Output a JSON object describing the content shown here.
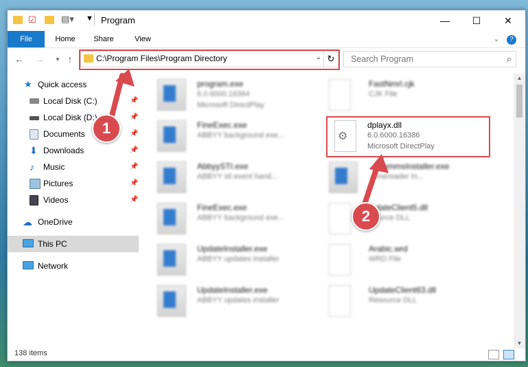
{
  "window": {
    "title": "Program"
  },
  "ribbon": {
    "tabs": [
      "File",
      "Home",
      "Share",
      "View"
    ]
  },
  "address": {
    "path": "C:\\Program Files\\Program Directory"
  },
  "search": {
    "placeholder": "Search Program"
  },
  "nav": {
    "quick_access": "Quick access",
    "items": [
      {
        "label": "Local Disk (C:)"
      },
      {
        "label": "Local Disk (D:)"
      },
      {
        "label": "Documents"
      },
      {
        "label": "Downloads"
      },
      {
        "label": "Music"
      },
      {
        "label": "Pictures"
      },
      {
        "label": "Videos"
      }
    ],
    "onedrive": "OneDrive",
    "thispc": "This PC",
    "network": "Network"
  },
  "files": [
    {
      "name": "program.exe",
      "line1": "6.0.6000.16384",
      "line2": "Microsoft DirectPlay"
    },
    {
      "name": "FastNmrl.cjk",
      "line1": "CJK File",
      "line2": ""
    },
    {
      "name": "FineExec.exe",
      "line1": "ABBYY background exe...",
      "line2": ""
    },
    {
      "name": "dplayx.dll",
      "line1": "6.0.6000.16386",
      "line2": "Microsoft DirectPlay"
    },
    {
      "name": "AbbyySTI.exe",
      "line1": "ABBYY sti event hand...",
      "line2": ""
    },
    {
      "name": "...grammsInstaller.exe",
      "line1": "...finereader In...",
      "line2": ""
    },
    {
      "name": "FineExec.exe",
      "line1": "ABBYY background exe...",
      "line2": ""
    },
    {
      "name": "...dateClient5.dll",
      "line1": "...ource DLL",
      "line2": ""
    },
    {
      "name": "UpdateInstaller.exe",
      "line1": "ABBYY updates installer",
      "line2": ""
    },
    {
      "name": "Arabic.wrd",
      "line1": "WRD File",
      "line2": ""
    },
    {
      "name": "UpdateInstaller.exe",
      "line1": "ABBYY updates installer",
      "line2": ""
    },
    {
      "name": "UpdateClient63.dll",
      "line1": "Resource DLL",
      "line2": ""
    }
  ],
  "status": {
    "count": "138 items"
  },
  "callouts": [
    "1",
    "2"
  ]
}
